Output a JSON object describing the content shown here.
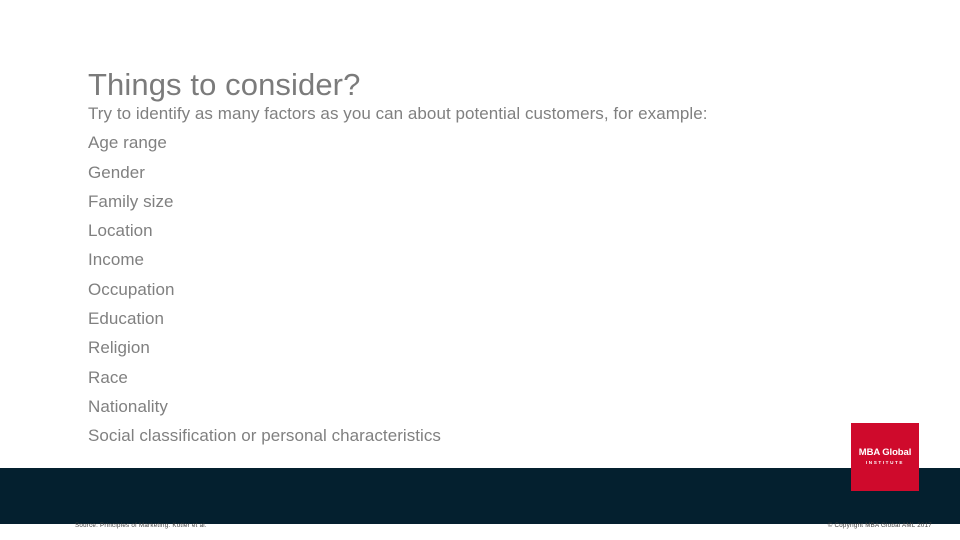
{
  "slide": {
    "title": "Things to consider?",
    "body_lines": [
      "Try to identify as many factors as you can about potential customers, for example:",
      "Age range",
      "Gender",
      "Family size",
      "Location",
      "Income",
      "Occupation",
      "Education",
      "Religion",
      "Race",
      "Nationality",
      "Social classification or personal characteristics"
    ]
  },
  "logo": {
    "name": "MBA Global",
    "subtitle": "INSTITUTE",
    "background_color": "#cf0a2c",
    "text_color": "#ffffff"
  },
  "footer": {
    "source": "Source: Principles of Marketing. Kotler et al.",
    "copyright": "© Copyright MBA Global AML 2017",
    "band_color": "#04202f"
  },
  "theme": {
    "title_color": "#7b7b7b",
    "body_color": "#808080",
    "background_color": "#ffffff"
  }
}
